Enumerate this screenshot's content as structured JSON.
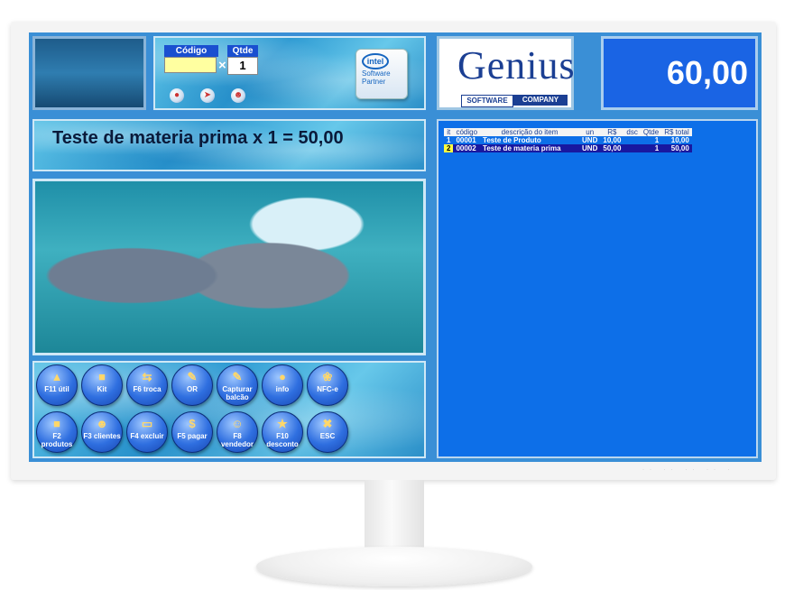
{
  "input": {
    "codigo_label": "Código",
    "qtde_label": "Qtde",
    "codigo_value": "",
    "times_sign": "×",
    "qtde_value": "1"
  },
  "intel": {
    "logo": "intel",
    "line1": "Software",
    "line2": "Partner"
  },
  "genius": {
    "name": "Genius",
    "tag_a": "SOFTWARE",
    "tag_b": "COMPANY"
  },
  "total": "60,00",
  "message": "Teste de materia prima x 1 = 50,00",
  "table": {
    "headers": [
      "it",
      "código",
      "descrição do item",
      "un",
      "R$",
      "dsc",
      "Qtde",
      "R$ total"
    ],
    "rows": [
      {
        "it": "1",
        "codigo": "00001",
        "descricao": "Teste de Produto",
        "un": "UND",
        "rs": "10,00",
        "dsc": "",
        "qtde": "1",
        "total": "10,00"
      },
      {
        "it": "2",
        "codigo": "00002",
        "descricao": "Teste de materia prima",
        "un": "UND",
        "rs": "50,00",
        "dsc": "",
        "qtde": "1",
        "total": "50,00"
      }
    ]
  },
  "buttons_row1": [
    "F11 útil",
    "Kit",
    "F6 troca",
    "OR",
    "Capturar balcão",
    "info",
    "NFC-e"
  ],
  "buttons_row2": [
    "F2 produtos",
    "F3 clientes",
    "F4 excluir",
    "F5 pagar",
    "F8 vendedor",
    "F10 desconto",
    "ESC"
  ],
  "icons": {
    "mini": [
      "binoculars-icon",
      "dolphin-icon",
      "figure-icon"
    ]
  }
}
